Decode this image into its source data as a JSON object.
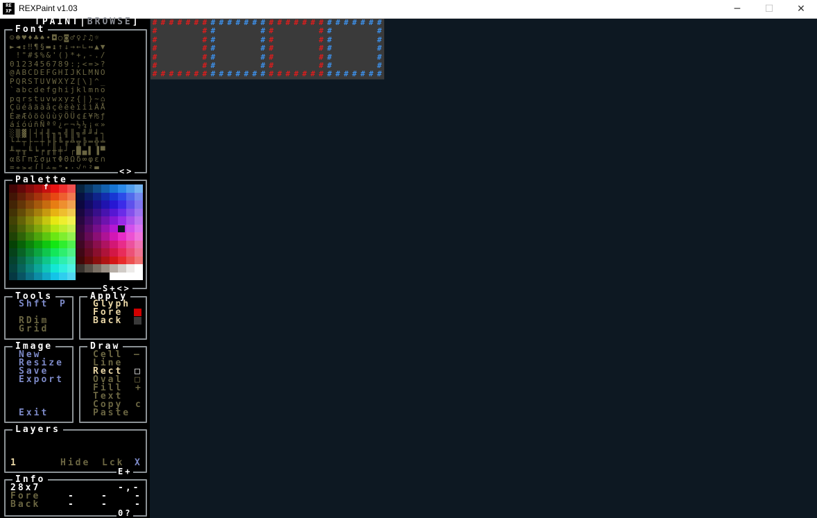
{
  "window": {
    "title": "REXPaint v1.03",
    "icon_text": "RE\nXP",
    "minimize": "─",
    "maximize": "☐",
    "close": "✕"
  },
  "mode_tabs": {
    "paint": "PAINT",
    "browse": "BROWSE",
    "display": "[PAINT|BROWSE]"
  },
  "font_panel": {
    "title": "Font",
    "nav": "<>"
  },
  "glyph_rows": [
    "☺☻♥♦♣♠•◘○◙♂♀♪♫☼",
    "►◄↕‼¶§▬↨↑↓→←∟↔▲▼",
    " !\"#$%&'()*+,-./",
    "0123456789:;<=>?",
    "@ABCDEFGHIJKLMNO",
    "PQRSTUVWXYZ[\\]^_",
    "`abcdefghijklmno",
    "pqrstuvwxyz{|}~⌂",
    "ÇüéâäàåçêëèïîìÄÅ",
    "ÉæÆôöòûùÿÖÜ¢£¥₧ƒ",
    "áíóúñÑªº¿⌐¬½¼¡«»",
    "░▒▓│┤╡╢╖╕╣║╗╝╜╛┐",
    "└┴┬├─┼╞╟╚╔╩╦╠═╬╧",
    "╨╤╥╙╘╒╓╫╪┘┌█▄▌▐▀",
    "αßΓπΣσµτΦΘΩδ∞φε∩",
    "≡±≥≤⌠⌡÷≈°∙·√ⁿ²■ "
  ],
  "palette_panel": {
    "title": "Palette",
    "selected_marker": "f",
    "nav": "S+<>"
  },
  "tools_panel": {
    "title": "Tools",
    "shift": "Shft",
    "p": "P",
    "rdim": "RDim",
    "grid": "Grid"
  },
  "apply_panel": {
    "title": "Apply",
    "glyph": "Glyph",
    "fore": "Fore",
    "back": "Back",
    "fore_color": "#d10000",
    "back_color": "#3a3a3a"
  },
  "image_panel": {
    "title": "Image",
    "new": "New",
    "resize": "Resize",
    "save": "Save",
    "export": "Export",
    "exit": "Exit"
  },
  "draw_panel": {
    "title": "Draw",
    "cell": "Cell",
    "cell_key": "—",
    "line": "Line",
    "rect": "Rect",
    "rect_key": "□",
    "oval": "Oval",
    "oval_key": "□",
    "fill": "Fill",
    "fill_key": "+",
    "text": "Text",
    "copy": "Copy",
    "copy_key": "c",
    "paste": "Paste"
  },
  "layers_panel": {
    "title": "Layers",
    "layer_num": "1",
    "hide": "Hide",
    "lock": "Lck",
    "x": "X",
    "nav": "E+"
  },
  "info_panel": {
    "title": "Info",
    "size": "28x7",
    "coords": "-,-",
    "fore": "Fore",
    "back": "Back",
    "dash": "-",
    "nav": "0?"
  },
  "canvas": {
    "glyph": "#",
    "red": "#d81e1e",
    "blue": "#3d8fe8",
    "bg": "#3a3a3a"
  },
  "colors": {
    "app_bg": "#0d1822",
    "panel_border": "#8c9296",
    "dim_text": "#6b6642"
  }
}
